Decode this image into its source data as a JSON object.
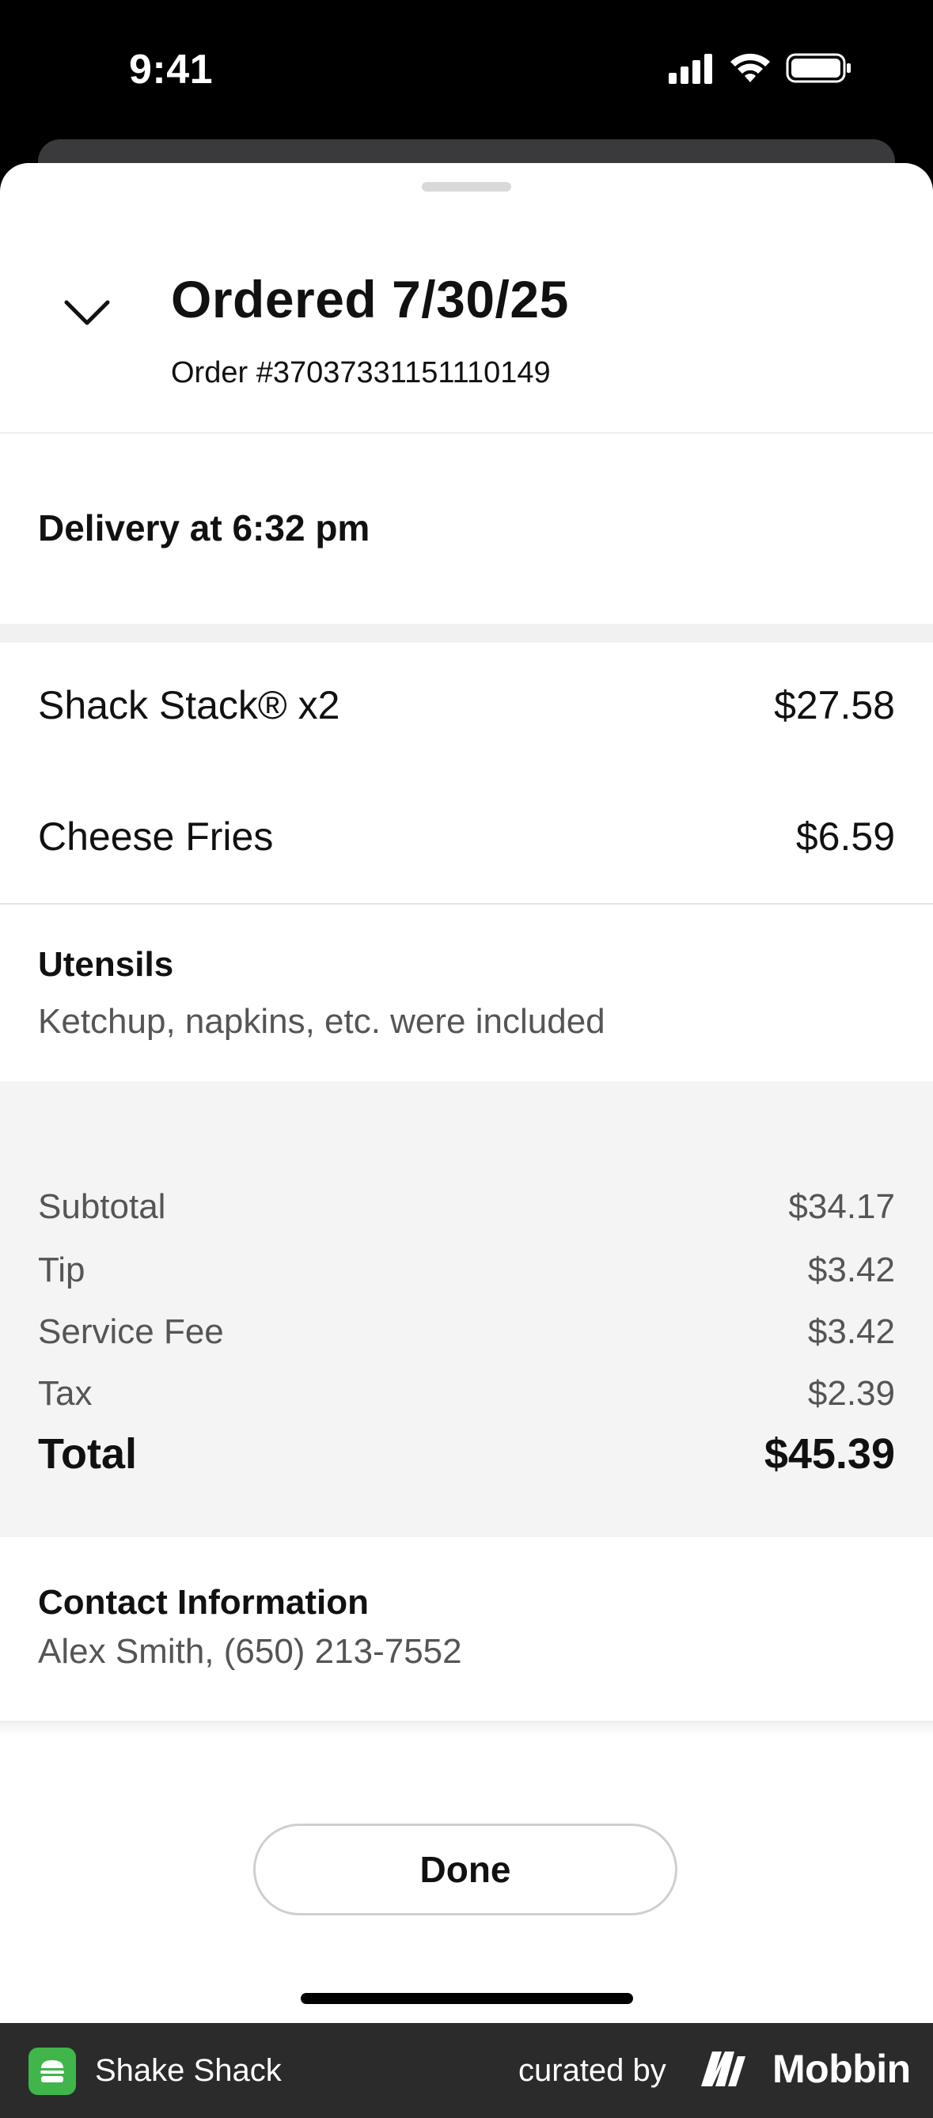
{
  "status_bar": {
    "time": "9:41"
  },
  "header": {
    "title": "Ordered 7/30/25",
    "order_number": "Order #37037331151110149"
  },
  "delivery": {
    "text": "Delivery at 6:32 pm"
  },
  "items": [
    {
      "name": "Shack Stack® x2",
      "price": "$27.58"
    },
    {
      "name": "Cheese Fries",
      "price": "$6.59"
    }
  ],
  "utensils": {
    "title": "Utensils",
    "description": "Ketchup, napkins, etc. were included"
  },
  "summary": {
    "lines": [
      {
        "label": "Subtotal",
        "value": "$34.17"
      },
      {
        "label": "Tip",
        "value": "$3.42"
      },
      {
        "label": "Service Fee",
        "value": "$3.42"
      },
      {
        "label": "Tax",
        "value": "$2.39"
      }
    ],
    "total_label": "Total",
    "total_value": "$45.39"
  },
  "contact": {
    "title": "Contact Information",
    "info": "Alex Smith, (650) 213-7552"
  },
  "actions": {
    "done_label": "Done"
  },
  "banner": {
    "app_name": "Shake Shack",
    "curated_by": "curated by",
    "brand": "Mobbin",
    "app_icon": "burger-icon",
    "app_icon_color": "#3fb54a"
  }
}
